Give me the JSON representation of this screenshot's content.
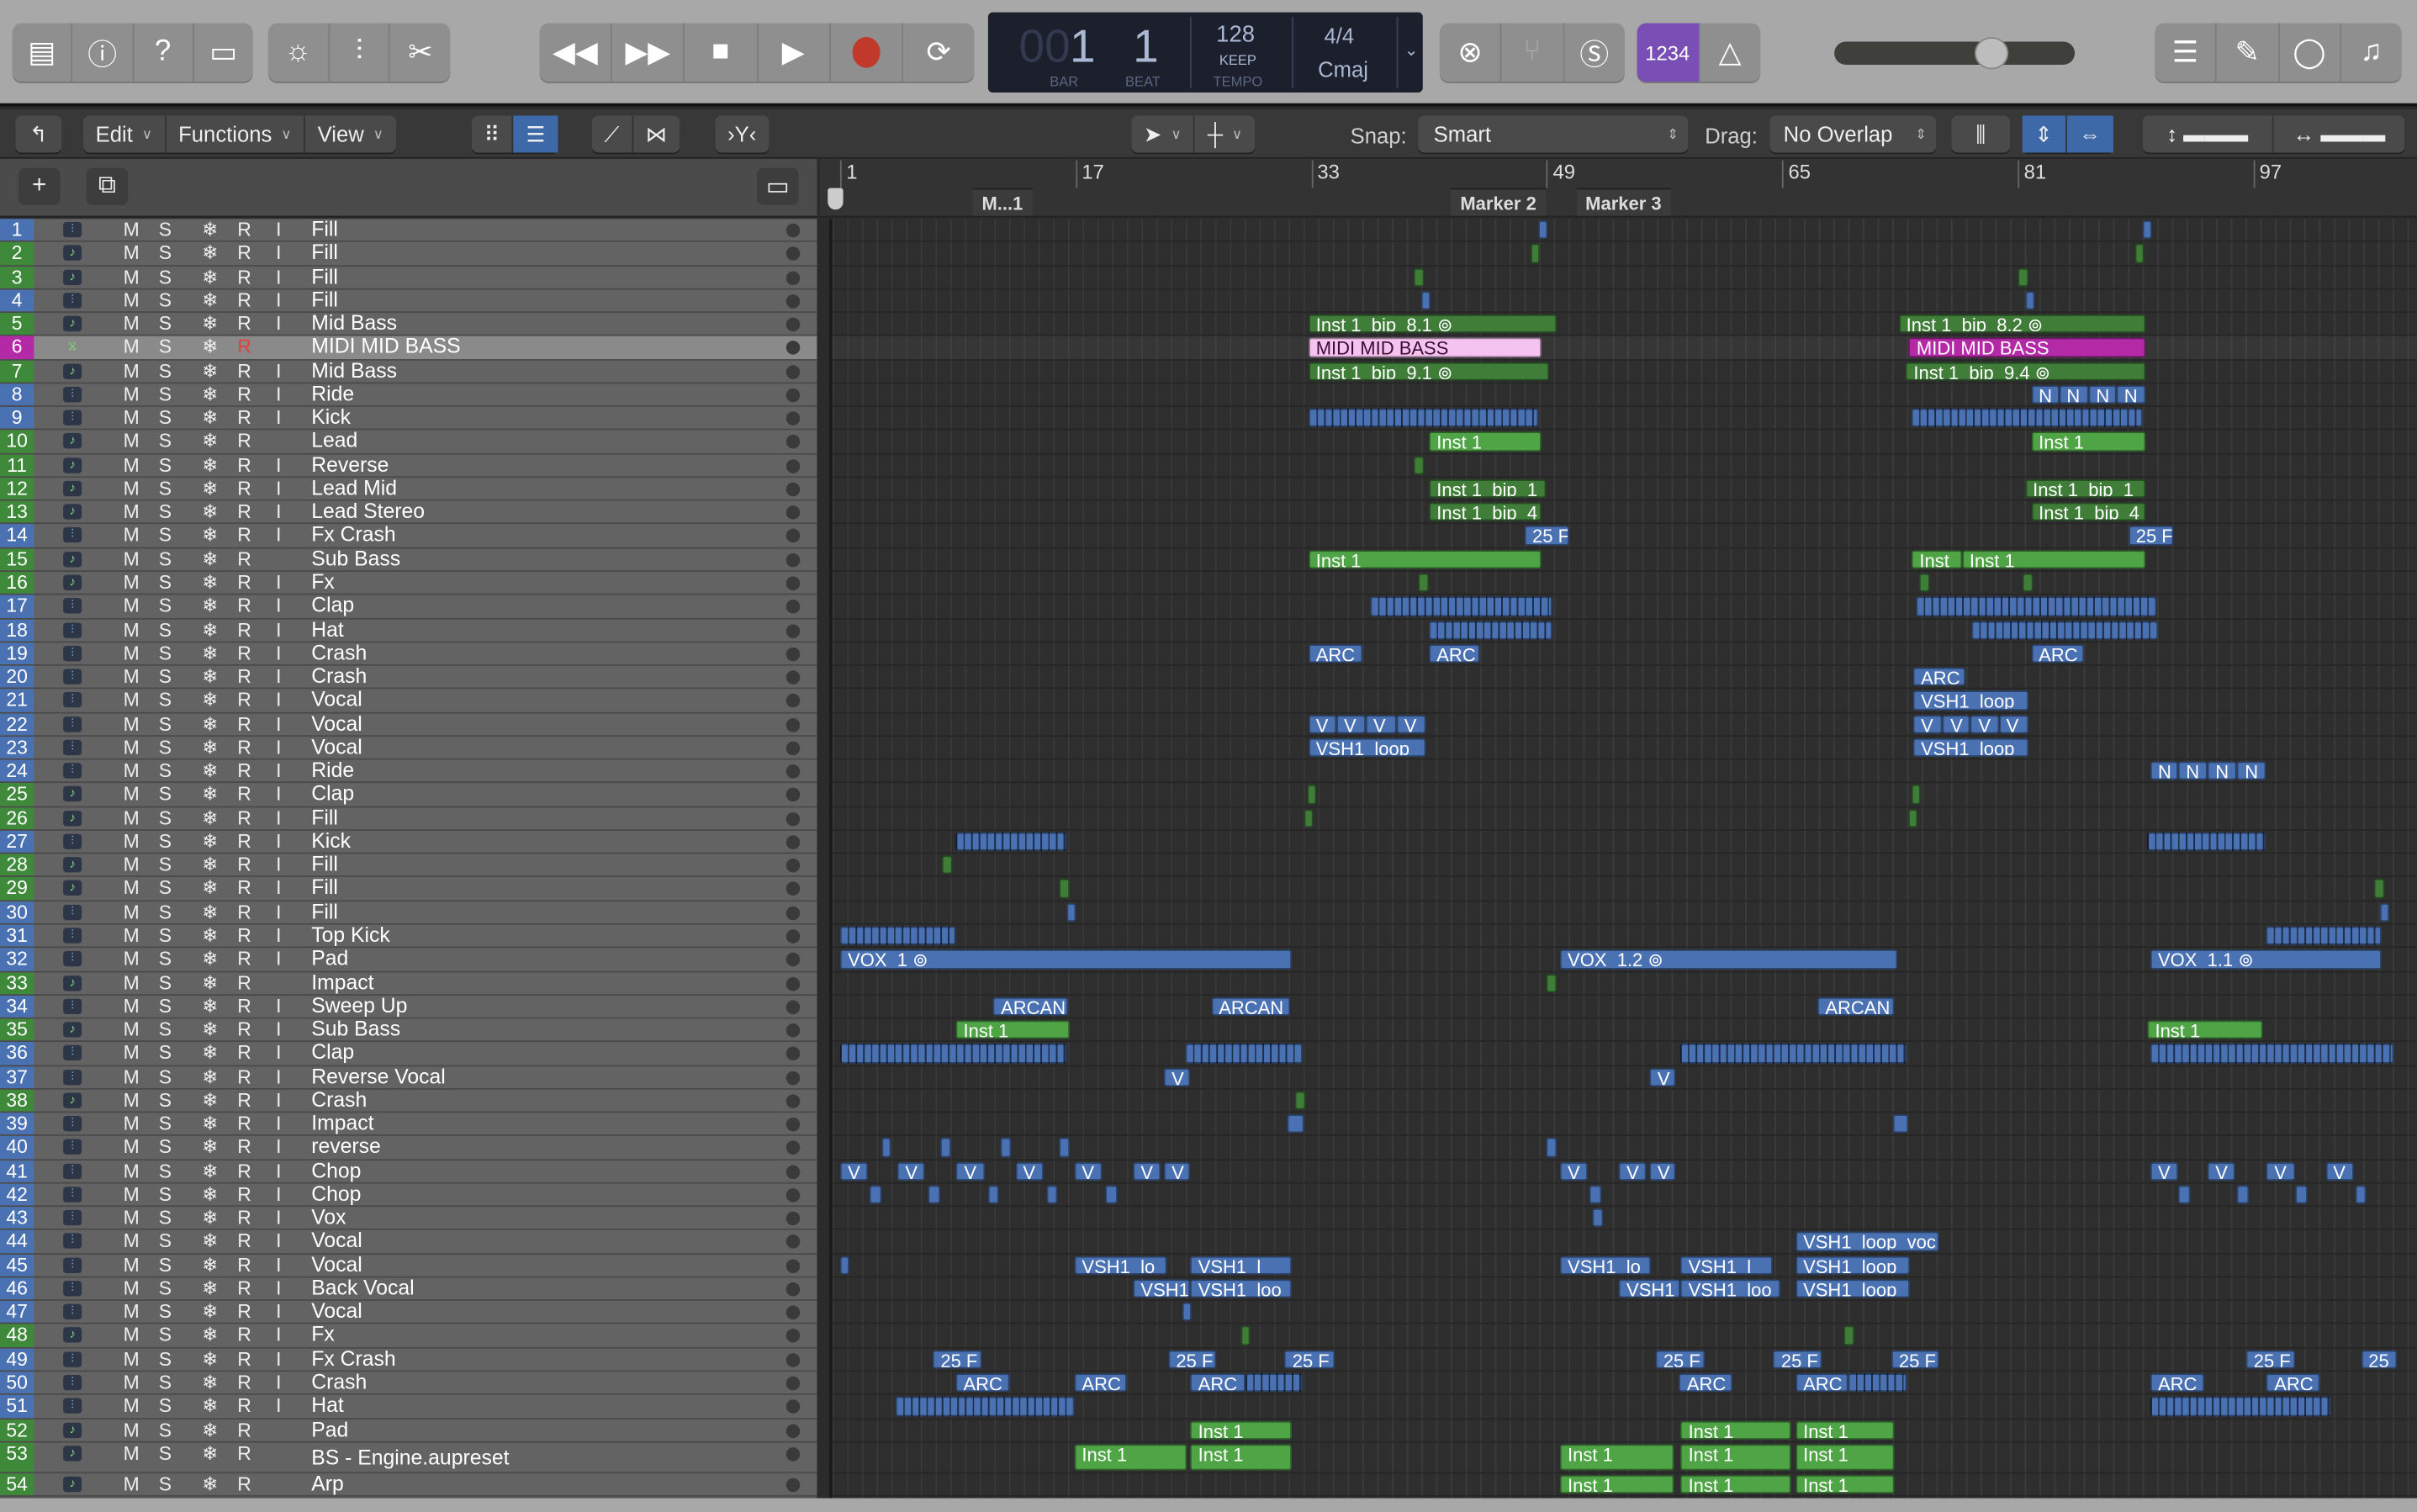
{
  "toolbar": {
    "left_icons": [
      "library-icon",
      "inspector-icon",
      "quick-help-icon",
      "toolbar-icon"
    ],
    "edit_icons": [
      "smart-controls-icon",
      "mixer-icon",
      "editors-scissors-icon"
    ],
    "transport": [
      "rewind-icon",
      "fast-forward-icon",
      "stop-icon",
      "play-icon",
      "record-icon",
      "cycle-icon"
    ],
    "lcd": {
      "bar_dim": "00",
      "bar": "1",
      "beat": "1",
      "bar_label": "BAR",
      "beat_label": "BEAT",
      "tempo": "128",
      "tempo_mode": "KEEP",
      "tempo_label": "TEMPO",
      "signature": "4/4",
      "key": "Cmaj"
    },
    "mode_icons": [
      "replace-icon",
      "tuner-icon",
      "solo-icon"
    ],
    "count_in": "1234",
    "master_volume": 0.68,
    "right_icons": [
      "list-editors-icon",
      "notepad-icon",
      "loop-browser-icon",
      "media-browser-icon"
    ],
    "record_color": "#c0392b",
    "count_in_color": "#7a4fb5"
  },
  "edit_bar": {
    "edit": "Edit",
    "functions": "Functions",
    "view": "View",
    "snap_label": "Snap:",
    "snap_value": "Smart",
    "drag_label": "Drag:",
    "drag_value": "No Overlap"
  },
  "ruler": {
    "bars": [
      "1",
      "17",
      "33",
      "49",
      "65",
      "81",
      "97"
    ],
    "markers": [
      "M...1",
      "Marker 2",
      "Marker 3"
    ]
  },
  "colors": {
    "b": "#4a72b3",
    "bs": "#4a72b3",
    "g": "#3f7d39",
    "lg": "#4fa446",
    "pk": "#f5c3ef",
    "mg": "#b42aa6",
    "audio": "#4a72b3",
    "inst": "#3f8a3a",
    "midi": "#b42aa6"
  },
  "tracks": [
    [
      "1",
      "Fill",
      "audio",
      1
    ],
    [
      "2",
      "Fill",
      "inst",
      1
    ],
    [
      "3",
      "Fill",
      "inst",
      1
    ],
    [
      "4",
      "Fill",
      "audio",
      1
    ],
    [
      "5",
      "Mid Bass",
      "inst",
      1
    ],
    [
      "6",
      "MIDI MID BASS",
      "midi",
      0
    ],
    [
      "7",
      "Mid Bass",
      "inst",
      1
    ],
    [
      "8",
      "Ride",
      "audio",
      1
    ],
    [
      "9",
      "Kick",
      "audio",
      1
    ],
    [
      "10",
      "Lead",
      "inst",
      0
    ],
    [
      "11",
      "Reverse",
      "inst",
      1
    ],
    [
      "12",
      "Lead Mid",
      "inst",
      1
    ],
    [
      "13",
      "Lead Stereo",
      "inst",
      1
    ],
    [
      "14",
      "Fx Crash",
      "audio",
      1
    ],
    [
      "15",
      "Sub Bass",
      "inst",
      0
    ],
    [
      "16",
      "Fx",
      "inst",
      1
    ],
    [
      "17",
      "Clap",
      "audio",
      1
    ],
    [
      "18",
      "Hat",
      "audio",
      1
    ],
    [
      "19",
      "Crash",
      "audio",
      1
    ],
    [
      "20",
      "Crash",
      "audio",
      1
    ],
    [
      "21",
      "Vocal",
      "audio",
      1
    ],
    [
      "22",
      "Vocal",
      "audio",
      1
    ],
    [
      "23",
      "Vocal",
      "audio",
      1
    ],
    [
      "24",
      "Ride",
      "audio",
      1
    ],
    [
      "25",
      "Clap",
      "inst",
      1
    ],
    [
      "26",
      "Fill",
      "inst",
      1
    ],
    [
      "27",
      "Kick",
      "audio",
      1
    ],
    [
      "28",
      "Fill",
      "inst",
      1
    ],
    [
      "29",
      "Fill",
      "inst",
      1
    ],
    [
      "30",
      "Fill",
      "audio",
      1
    ],
    [
      "31",
      "Top Kick",
      "audio",
      1
    ],
    [
      "32",
      "Pad",
      "audio",
      1
    ],
    [
      "33",
      "Impact",
      "inst",
      0
    ],
    [
      "34",
      "Sweep Up",
      "audio",
      1
    ],
    [
      "35",
      "Sub Bass",
      "inst",
      1
    ],
    [
      "36",
      "Clap",
      "audio",
      1
    ],
    [
      "37",
      "Reverse Vocal",
      "audio",
      1
    ],
    [
      "38",
      "Crash",
      "inst",
      1
    ],
    [
      "39",
      "Impact",
      "audio",
      1
    ],
    [
      "40",
      "reverse",
      "audio",
      1
    ],
    [
      "41",
      "Chop",
      "audio",
      1
    ],
    [
      "42",
      "Chop",
      "audio",
      1
    ],
    [
      "43",
      "Vox",
      "audio",
      1
    ],
    [
      "44",
      "Vocal",
      "audio",
      1
    ],
    [
      "45",
      "Vocal",
      "audio",
      1
    ],
    [
      "46",
      "Back Vocal",
      "audio",
      1
    ],
    [
      "47",
      "Vocal",
      "audio",
      1
    ],
    [
      "48",
      "Fx",
      "inst",
      1
    ],
    [
      "49",
      "Fx Crash",
      "audio",
      1
    ],
    [
      "50",
      "Crash",
      "audio",
      1
    ],
    [
      "51",
      "Hat",
      "audio",
      1
    ],
    [
      "52",
      "Pad",
      "inst",
      0
    ],
    [
      "53",
      "BS - Engine.aupreset",
      "inst",
      0
    ],
    [
      "54",
      "Arp",
      "inst",
      0
    ]
  ],
  "track_buttons": {
    "mute": "M",
    "solo": "S",
    "freeze": "❄",
    "record": "R",
    "input": "I"
  },
  "regions": [
    [
      1,
      48.4,
      49,
      "b",
      ""
    ],
    [
      1,
      89.5,
      90,
      "b",
      ""
    ],
    [
      2,
      47.9,
      48.5,
      "g",
      ""
    ],
    [
      2,
      89,
      89.6,
      "g",
      ""
    ],
    [
      3,
      40,
      40.7,
      "g",
      ""
    ],
    [
      3,
      81,
      81.7,
      "g",
      ""
    ],
    [
      4,
      40.5,
      41.1,
      "b",
      ""
    ],
    [
      4,
      81.5,
      82.1,
      "b",
      ""
    ],
    [
      5,
      32.8,
      49.7,
      "g",
      "Inst 1_bip_8.1 ⊚"
    ],
    [
      5,
      72.9,
      89.7,
      "g",
      "Inst 1_bip_8.2 ⊚"
    ],
    [
      6,
      32.8,
      48.6,
      "pk",
      "MIDI MID BASS"
    ],
    [
      6,
      73.6,
      89.7,
      "mg",
      "MIDI MID BASS"
    ],
    [
      7,
      32.8,
      49.2,
      "g",
      "Inst 1_bip_9.1 ⊚"
    ],
    [
      7,
      73.4,
      89.7,
      "g",
      "Inst 1_bip_9.4 ⊚"
    ],
    [
      8,
      81.9,
      83.8,
      "b",
      "N"
    ],
    [
      8,
      83.8,
      85.8,
      "b",
      "N"
    ],
    [
      8,
      85.8,
      87.7,
      "b",
      "N"
    ],
    [
      8,
      87.7,
      89.7,
      "b",
      "N"
    ],
    [
      9,
      32.8,
      48.4,
      "bs",
      ""
    ],
    [
      9,
      73.8,
      89.5,
      "bs",
      ""
    ],
    [
      10,
      41,
      48.6,
      "lg",
      "Inst 1"
    ],
    [
      10,
      81.9,
      89.7,
      "lg",
      "Inst 1"
    ],
    [
      11,
      40,
      40.7,
      "g",
      ""
    ],
    [
      12,
      41,
      49,
      "g",
      "Inst 1_bip_1"
    ],
    [
      12,
      81.5,
      89.7,
      "g",
      "Inst 1_bip_1"
    ],
    [
      13,
      41,
      48.6,
      "g",
      "Inst 1_bip_4"
    ],
    [
      13,
      81.9,
      89.7,
      "g",
      "Inst 1_bip_4"
    ],
    [
      14,
      47.5,
      50.5,
      "b",
      "25 F"
    ],
    [
      14,
      88.5,
      91.6,
      "b",
      "25 F"
    ],
    [
      15,
      32.8,
      48.6,
      "lg",
      "Inst 1"
    ],
    [
      15,
      73.8,
      77.2,
      "lg",
      "Inst"
    ],
    [
      15,
      77.2,
      89.7,
      "lg",
      "Inst 1"
    ],
    [
      16,
      40.3,
      41,
      "g",
      ""
    ],
    [
      16,
      74.3,
      75,
      "g",
      ""
    ],
    [
      16,
      81.3,
      82,
      "g",
      ""
    ],
    [
      17,
      37,
      49.4,
      "bs",
      ""
    ],
    [
      17,
      74.1,
      90.4,
      "bs",
      ""
    ],
    [
      18,
      41,
      49.4,
      "bs",
      ""
    ],
    [
      18,
      77.9,
      90.5,
      "bs",
      ""
    ],
    [
      19,
      32.8,
      36.5,
      "b",
      "ARC"
    ],
    [
      19,
      41,
      44.5,
      "b",
      "ARC"
    ],
    [
      19,
      81.9,
      85.5,
      "b",
      "ARC"
    ],
    [
      20,
      73.9,
      77.4,
      "b",
      "ARC"
    ],
    [
      21,
      73.9,
      81.7,
      "b",
      "VSH1_loop_"
    ],
    [
      22,
      32.8,
      34.7,
      "b",
      "V"
    ],
    [
      22,
      34.7,
      36.7,
      "b",
      "V"
    ],
    [
      22,
      36.7,
      38.8,
      "b",
      "V"
    ],
    [
      22,
      38.8,
      40.8,
      "b",
      "V"
    ],
    [
      22,
      73.9,
      75.9,
      "b",
      "V"
    ],
    [
      22,
      75.9,
      77.8,
      "b",
      "V"
    ],
    [
      22,
      77.8,
      79.7,
      "b",
      "V"
    ],
    [
      22,
      79.7,
      81.7,
      "b",
      "V"
    ],
    [
      23,
      32.8,
      40.8,
      "b",
      "VSH1_loop_"
    ],
    [
      23,
      73.9,
      81.7,
      "b",
      "VSH1_loop_"
    ],
    [
      24,
      90,
      91.9,
      "b",
      "N"
    ],
    [
      24,
      91.9,
      93.9,
      "b",
      "N"
    ],
    [
      24,
      93.9,
      95.9,
      "b",
      "N"
    ],
    [
      24,
      95.9,
      97.9,
      "b",
      "N"
    ],
    [
      25,
      32.7,
      33.3,
      "g",
      ""
    ],
    [
      25,
      73.8,
      74.4,
      "g",
      ""
    ],
    [
      26,
      32.5,
      33.1,
      "g",
      ""
    ],
    [
      26,
      73.6,
      74.2,
      "g",
      ""
    ],
    [
      27,
      8.85,
      16.4,
      "bs",
      ""
    ],
    [
      27,
      89.8,
      97.9,
      "bs",
      ""
    ],
    [
      28,
      7.9,
      8.6,
      "g",
      ""
    ],
    [
      29,
      15.9,
      16.6,
      "g",
      ""
    ],
    [
      29,
      105.2,
      105.9,
      "g",
      ""
    ],
    [
      30,
      16.4,
      17,
      "b",
      ""
    ],
    [
      30,
      105.6,
      106.2,
      "b",
      ""
    ],
    [
      31,
      1,
      8.85,
      "bs",
      ""
    ],
    [
      31,
      97.9,
      105.7,
      "bs",
      ""
    ],
    [
      32,
      1,
      31.7,
      "b",
      "VOX_1 ⊚"
    ],
    [
      32,
      49.9,
      72.8,
      "b",
      "VOX_1.2 ⊚"
    ],
    [
      32,
      90,
      105.7,
      "b",
      "VOX_1.1 ⊚"
    ],
    [
      33,
      49,
      49.7,
      "g",
      ""
    ],
    [
      34,
      11.4,
      16.5,
      "b",
      "ARCAN"
    ],
    [
      34,
      26.2,
      31.6,
      "b",
      "ARCAN"
    ],
    [
      34,
      67.4,
      72.6,
      "b",
      "ARCAN"
    ],
    [
      35,
      8.85,
      16.6,
      "lg",
      "Inst 1"
    ],
    [
      35,
      89.8,
      97.6,
      "lg",
      "Inst 1"
    ],
    [
      36,
      1,
      16.4,
      "bs",
      ""
    ],
    [
      36,
      24.5,
      32.4,
      "bs",
      ""
    ],
    [
      36,
      58.1,
      73.5,
      "bs",
      ""
    ],
    [
      36,
      90,
      106.5,
      "bs",
      ""
    ],
    [
      37,
      23,
      24.8,
      "b",
      "V"
    ],
    [
      37,
      56,
      57.8,
      "b",
      "V"
    ],
    [
      38,
      31.9,
      32.6,
      "g",
      ""
    ],
    [
      39,
      31.4,
      32.5,
      "b",
      ""
    ],
    [
      39,
      72.5,
      73.6,
      "b",
      ""
    ],
    [
      40,
      3.8,
      4.5,
      "b",
      ""
    ],
    [
      40,
      7.8,
      8.5,
      "b",
      ""
    ],
    [
      40,
      11.9,
      12.6,
      "b",
      ""
    ],
    [
      40,
      15.9,
      16.6,
      "b",
      ""
    ],
    [
      40,
      49,
      49.7,
      "b",
      ""
    ],
    [
      41,
      1,
      2.9,
      "b",
      "V"
    ],
    [
      41,
      4.9,
      6.8,
      "b",
      "V"
    ],
    [
      41,
      8.9,
      10.8,
      "b",
      "V"
    ],
    [
      41,
      12.9,
      14.8,
      "b",
      "V"
    ],
    [
      41,
      16.9,
      18.8,
      "b",
      "V"
    ],
    [
      41,
      20.9,
      22.8,
      "b",
      "V"
    ],
    [
      41,
      23,
      24.8,
      "b",
      "V"
    ],
    [
      41,
      49.9,
      51.8,
      "b",
      "V"
    ],
    [
      41,
      53.9,
      55.8,
      "b",
      "V"
    ],
    [
      41,
      56,
      57.8,
      "b",
      "V"
    ],
    [
      41,
      90,
      91.9,
      "b",
      "V"
    ],
    [
      41,
      93.9,
      95.8,
      "b",
      "V"
    ],
    [
      41,
      97.9,
      99.8,
      "b",
      "V"
    ],
    [
      41,
      101.9,
      103.8,
      "b",
      "V"
    ],
    [
      42,
      3,
      3.8,
      "b",
      ""
    ],
    [
      42,
      7,
      7.8,
      "b",
      ""
    ],
    [
      42,
      11,
      11.8,
      "b",
      ""
    ],
    [
      42,
      15,
      15.8,
      "b",
      ""
    ],
    [
      42,
      19,
      19.8,
      "b",
      ""
    ],
    [
      42,
      51.9,
      52.7,
      "b",
      ""
    ],
    [
      42,
      91.9,
      92.7,
      "b",
      ""
    ],
    [
      42,
      95.9,
      96.7,
      "b",
      ""
    ],
    [
      42,
      99.9,
      100.7,
      "b",
      ""
    ],
    [
      42,
      103.9,
      104.7,
      "b",
      ""
    ],
    [
      43,
      52.1,
      52.8,
      "b",
      ""
    ],
    [
      44,
      65.9,
      75.7,
      "b",
      "VSH1_loop_voc"
    ],
    [
      45,
      1,
      1.6,
      "b",
      ""
    ],
    [
      45,
      16.9,
      23.2,
      "b",
      "VSH1_lo"
    ],
    [
      45,
      24.8,
      31.7,
      "b",
      "VSH1_l"
    ],
    [
      45,
      49.9,
      56.1,
      "b",
      "VSH1_lo"
    ],
    [
      45,
      58.1,
      64.4,
      "b",
      "VSH1_l"
    ],
    [
      45,
      65.9,
      73.7,
      "b",
      "VSH1_loop_"
    ],
    [
      46,
      20.9,
      24.8,
      "b",
      "VSH1"
    ],
    [
      46,
      24.8,
      31.7,
      "b",
      "VSH1_loo"
    ],
    [
      46,
      53.9,
      58.1,
      "b",
      "VSH1"
    ],
    [
      46,
      58.1,
      64.9,
      "b",
      "VSH1_loo"
    ],
    [
      46,
      65.9,
      73.7,
      "b",
      "VSH1_loop_"
    ],
    [
      47,
      24.2,
      24.9,
      "b",
      ""
    ],
    [
      48,
      28.2,
      28.9,
      "g",
      ""
    ],
    [
      48,
      69.2,
      69.9,
      "g",
      ""
    ],
    [
      49,
      7.3,
      10.6,
      "b",
      "25 F"
    ],
    [
      49,
      23.3,
      26.6,
      "b",
      "25 F"
    ],
    [
      49,
      31.2,
      34.6,
      "b",
      "25 F"
    ],
    [
      49,
      56.4,
      59.7,
      "b",
      "25 F"
    ],
    [
      49,
      64.4,
      67.7,
      "b",
      "25 F"
    ],
    [
      49,
      72.4,
      75.7,
      "b",
      "25 F"
    ],
    [
      49,
      96.5,
      99.8,
      "b",
      "25 F"
    ],
    [
      49,
      104.3,
      106.8,
      "b",
      "25 F"
    ],
    [
      50,
      8.85,
      12.5,
      "b",
      "ARC"
    ],
    [
      50,
      16.9,
      20.5,
      "b",
      "ARC"
    ],
    [
      50,
      24.8,
      28.5,
      "b",
      "ARC"
    ],
    [
      50,
      28.5,
      32.4,
      "bs",
      ""
    ],
    [
      50,
      58,
      61.6,
      "b",
      "ARC"
    ],
    [
      50,
      65.9,
      69.5,
      "b",
      "ARC"
    ],
    [
      50,
      69.5,
      73.5,
      "bs",
      ""
    ],
    [
      50,
      90,
      93.7,
      "b",
      "ARC"
    ],
    [
      50,
      97.9,
      101.5,
      "b",
      "ARC"
    ],
    [
      51,
      4.8,
      16.9,
      "bs",
      ""
    ],
    [
      51,
      90,
      102.3,
      "bs",
      ""
    ],
    [
      52,
      24.8,
      31.7,
      "lg",
      "Inst 1"
    ],
    [
      52,
      58.1,
      65.6,
      "lg",
      "Inst 1"
    ],
    [
      52,
      65.9,
      72.6,
      "lg",
      "Inst 1"
    ],
    [
      53,
      16.9,
      24.6,
      "lg",
      "Inst 1"
    ],
    [
      53,
      24.8,
      31.7,
      "lg",
      "Inst 1"
    ],
    [
      53,
      49.9,
      57.7,
      "lg",
      "Inst 1"
    ],
    [
      53,
      58.1,
      65.6,
      "lg",
      "Inst 1"
    ],
    [
      53,
      65.9,
      72.6,
      "lg",
      "Inst 1"
    ],
    [
      54,
      49.9,
      57.7,
      "lg",
      "Inst 1"
    ],
    [
      54,
      58.1,
      65.6,
      "lg",
      "Inst 1"
    ],
    [
      54,
      65.9,
      72.6,
      "lg",
      "Inst 1"
    ]
  ]
}
